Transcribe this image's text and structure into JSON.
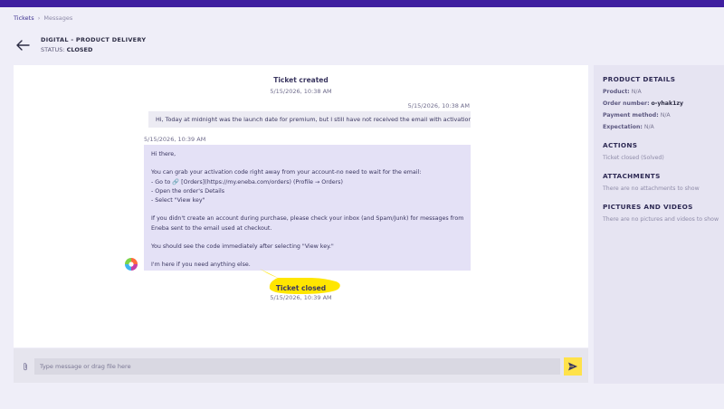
{
  "colors": {
    "topbar": "#3f1fa0",
    "highlight": "#ffe600",
    "send_button": "#ffe24a",
    "agent_bubble": "#e4e1f6"
  },
  "breadcrumb": {
    "tickets": "Tickets",
    "separator": "›",
    "messages": "Messages"
  },
  "ticket": {
    "title": "DIGITAL - PRODUCT DELIVERY",
    "status_label": "STATUS:",
    "status_value": "CLOSED"
  },
  "chat": {
    "created_title": "Ticket created",
    "created_time": "5/15/2026, 10:38 AM",
    "user_message": {
      "time": "5/15/2026, 10:38 AM",
      "text": "Hi, Today at midnight was the launch date for premium, but I still have not received the email with activation code."
    },
    "agent_message": {
      "time": "5/15/2026, 10:39 AM",
      "lines": [
        "Hi there,",
        "",
        "You can grab your activation code right away from your account-no need to wait for the email:",
        "- Go to 🔗 [Orders](https://my.eneba.com/orders) (Profile → Orders)",
        "- Open the order's Details",
        "- Select \"View key\"",
        "",
        "If you didn't create an account during purchase, please check your inbox (and Spam/Junk) for messages from",
        "Eneba sent to the email used at checkout.",
        "",
        "You should see the code immediately after selecting \"View key.\"",
        "",
        "I'm here if you need anything else."
      ]
    },
    "closed_title": "Ticket closed",
    "closed_time": "5/15/2026, 10:39 AM"
  },
  "composer": {
    "placeholder": "Type message or drag file here",
    "value": ""
  },
  "sidebar": {
    "product_details": {
      "heading": "PRODUCT DETAILS",
      "product_label": "Product:",
      "product_value": "N/A",
      "order_label": "Order number:",
      "order_value": "o-yhak1zy",
      "payment_label": "Payment method:",
      "payment_value": "N/A",
      "expectation_label": "Expectation:",
      "expectation_value": "N/A"
    },
    "actions": {
      "heading": "ACTIONS",
      "text": "Ticket closed (Solved)"
    },
    "attachments": {
      "heading": "ATTACHMENTS",
      "text": "There are no attachments to show"
    },
    "media": {
      "heading": "PICTURES AND VIDEOS",
      "text": "There are no pictures and videos to show"
    }
  },
  "icons": {
    "back": "arrow-left-icon",
    "attach": "paperclip-icon",
    "send": "send-icon",
    "avatar": "agent-avatar-icon"
  }
}
